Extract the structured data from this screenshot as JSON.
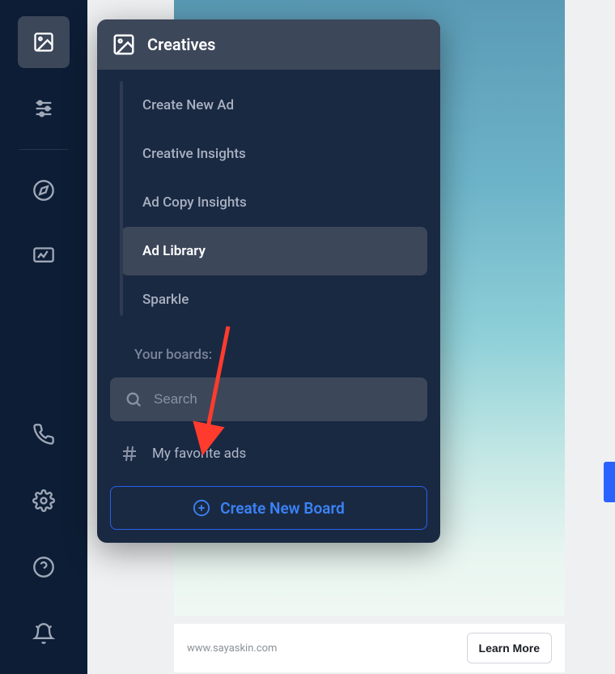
{
  "popover": {
    "title": "Creatives",
    "menu": [
      {
        "label": "Create New Ad"
      },
      {
        "label": "Creative Insights"
      },
      {
        "label": "Ad Copy Insights"
      },
      {
        "label": "Ad Library",
        "selected": true
      },
      {
        "label": "Sparkle"
      }
    ]
  },
  "boards": {
    "section_label": "Your boards:",
    "search_placeholder": "Search",
    "items": [
      {
        "name": "My favorite ads"
      }
    ],
    "create_button": "Create New Board"
  },
  "card": {
    "url": "www.sayaskin.com",
    "cta": "Learn More"
  }
}
